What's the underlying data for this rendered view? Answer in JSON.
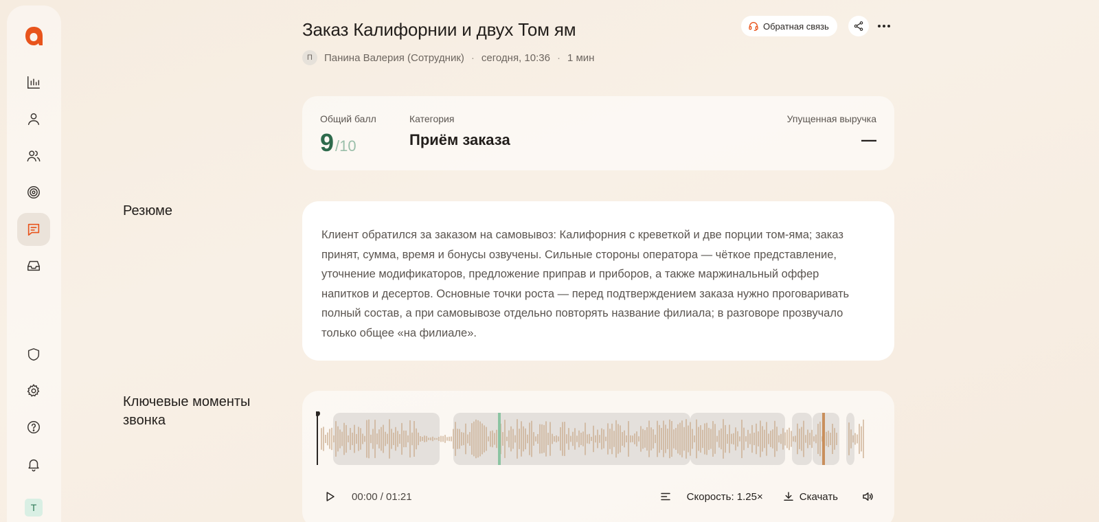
{
  "header": {
    "title": "Заказ Калифорнии и двух Том ям",
    "author_initial": "П",
    "author": "Панина Валерия (Сотрудник)",
    "sep1": "·",
    "date": "сегодня, 10:36",
    "sep2": "·",
    "duration": "1 мин",
    "feedback_label": "Обратная связь"
  },
  "sidebar": {
    "items": [
      {
        "icon": "bar-chart-icon"
      },
      {
        "icon": "user-icon"
      },
      {
        "icon": "users-icon"
      },
      {
        "icon": "target-icon"
      },
      {
        "icon": "chat-message-icon",
        "active": true
      },
      {
        "icon": "inbox-icon"
      },
      {
        "icon": "shield-icon"
      },
      {
        "icon": "gear-icon"
      },
      {
        "icon": "help-icon"
      },
      {
        "icon": "bell-icon"
      }
    ],
    "avatar_initial": "Т"
  },
  "score_card": {
    "score_label": "Общий балл",
    "score_value": "9",
    "score_max": "/10",
    "category_label": "Категория",
    "category_value": "Приём заказа",
    "lost_revenue_label": "Упущенная выручка",
    "lost_revenue_value": "—"
  },
  "summary": {
    "label": "Резюме",
    "text": "Клиент обратился за заказом на самовывоз: Калифорния с креветкой и две порции том-яма; заказ принят, сумма, время и бонусы озвучены. Сильные стороны оператора — чёткое представление, уточнение модификаторов, предложение приправ и приборов, а также маржинальный оффер напитков и десертов. Основные точки роста — перед подтверждением заказа нужно проговаривать полный состав, а при самовывозе отдельно повторять название филиала; в разговоре прозвучало только общее «на филиале»."
  },
  "moments": {
    "label": "Ключевые моменты звонка",
    "time": "00:00 / 01:21",
    "speed": "Скорость: 1.25×",
    "download": "Скачать",
    "colors": {
      "wave": "#c8a98a",
      "segment": "#e4e0dc",
      "marker_green": "#8cc4a2",
      "marker_orange": "#c98f5c",
      "accent": "#e8541c"
    }
  }
}
